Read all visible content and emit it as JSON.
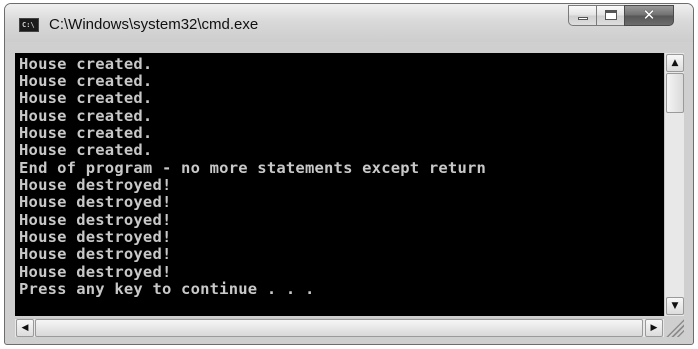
{
  "window": {
    "title": "C:\\Windows\\system32\\cmd.exe",
    "icon_label": "C:\\",
    "controls": {
      "minimize_icon": "minimize-icon",
      "maximize_icon": "maximize-icon",
      "close_icon": "close-icon",
      "close_glyph": "✕"
    }
  },
  "console": {
    "background": "#000000",
    "foreground": "#c8c8c8",
    "lines": [
      "House created.",
      "House created.",
      "House created.",
      "House created.",
      "House created.",
      "House created.",
      "End of program - no more statements except return",
      "House destroyed!",
      "House destroyed!",
      "House destroyed!",
      "House destroyed!",
      "House destroyed!",
      "House destroyed!",
      "Press any key to continue . . ."
    ]
  },
  "scrollbars": {
    "up_arrow": "▲",
    "down_arrow": "▼",
    "left_arrow": "◀",
    "right_arrow": "▶"
  }
}
